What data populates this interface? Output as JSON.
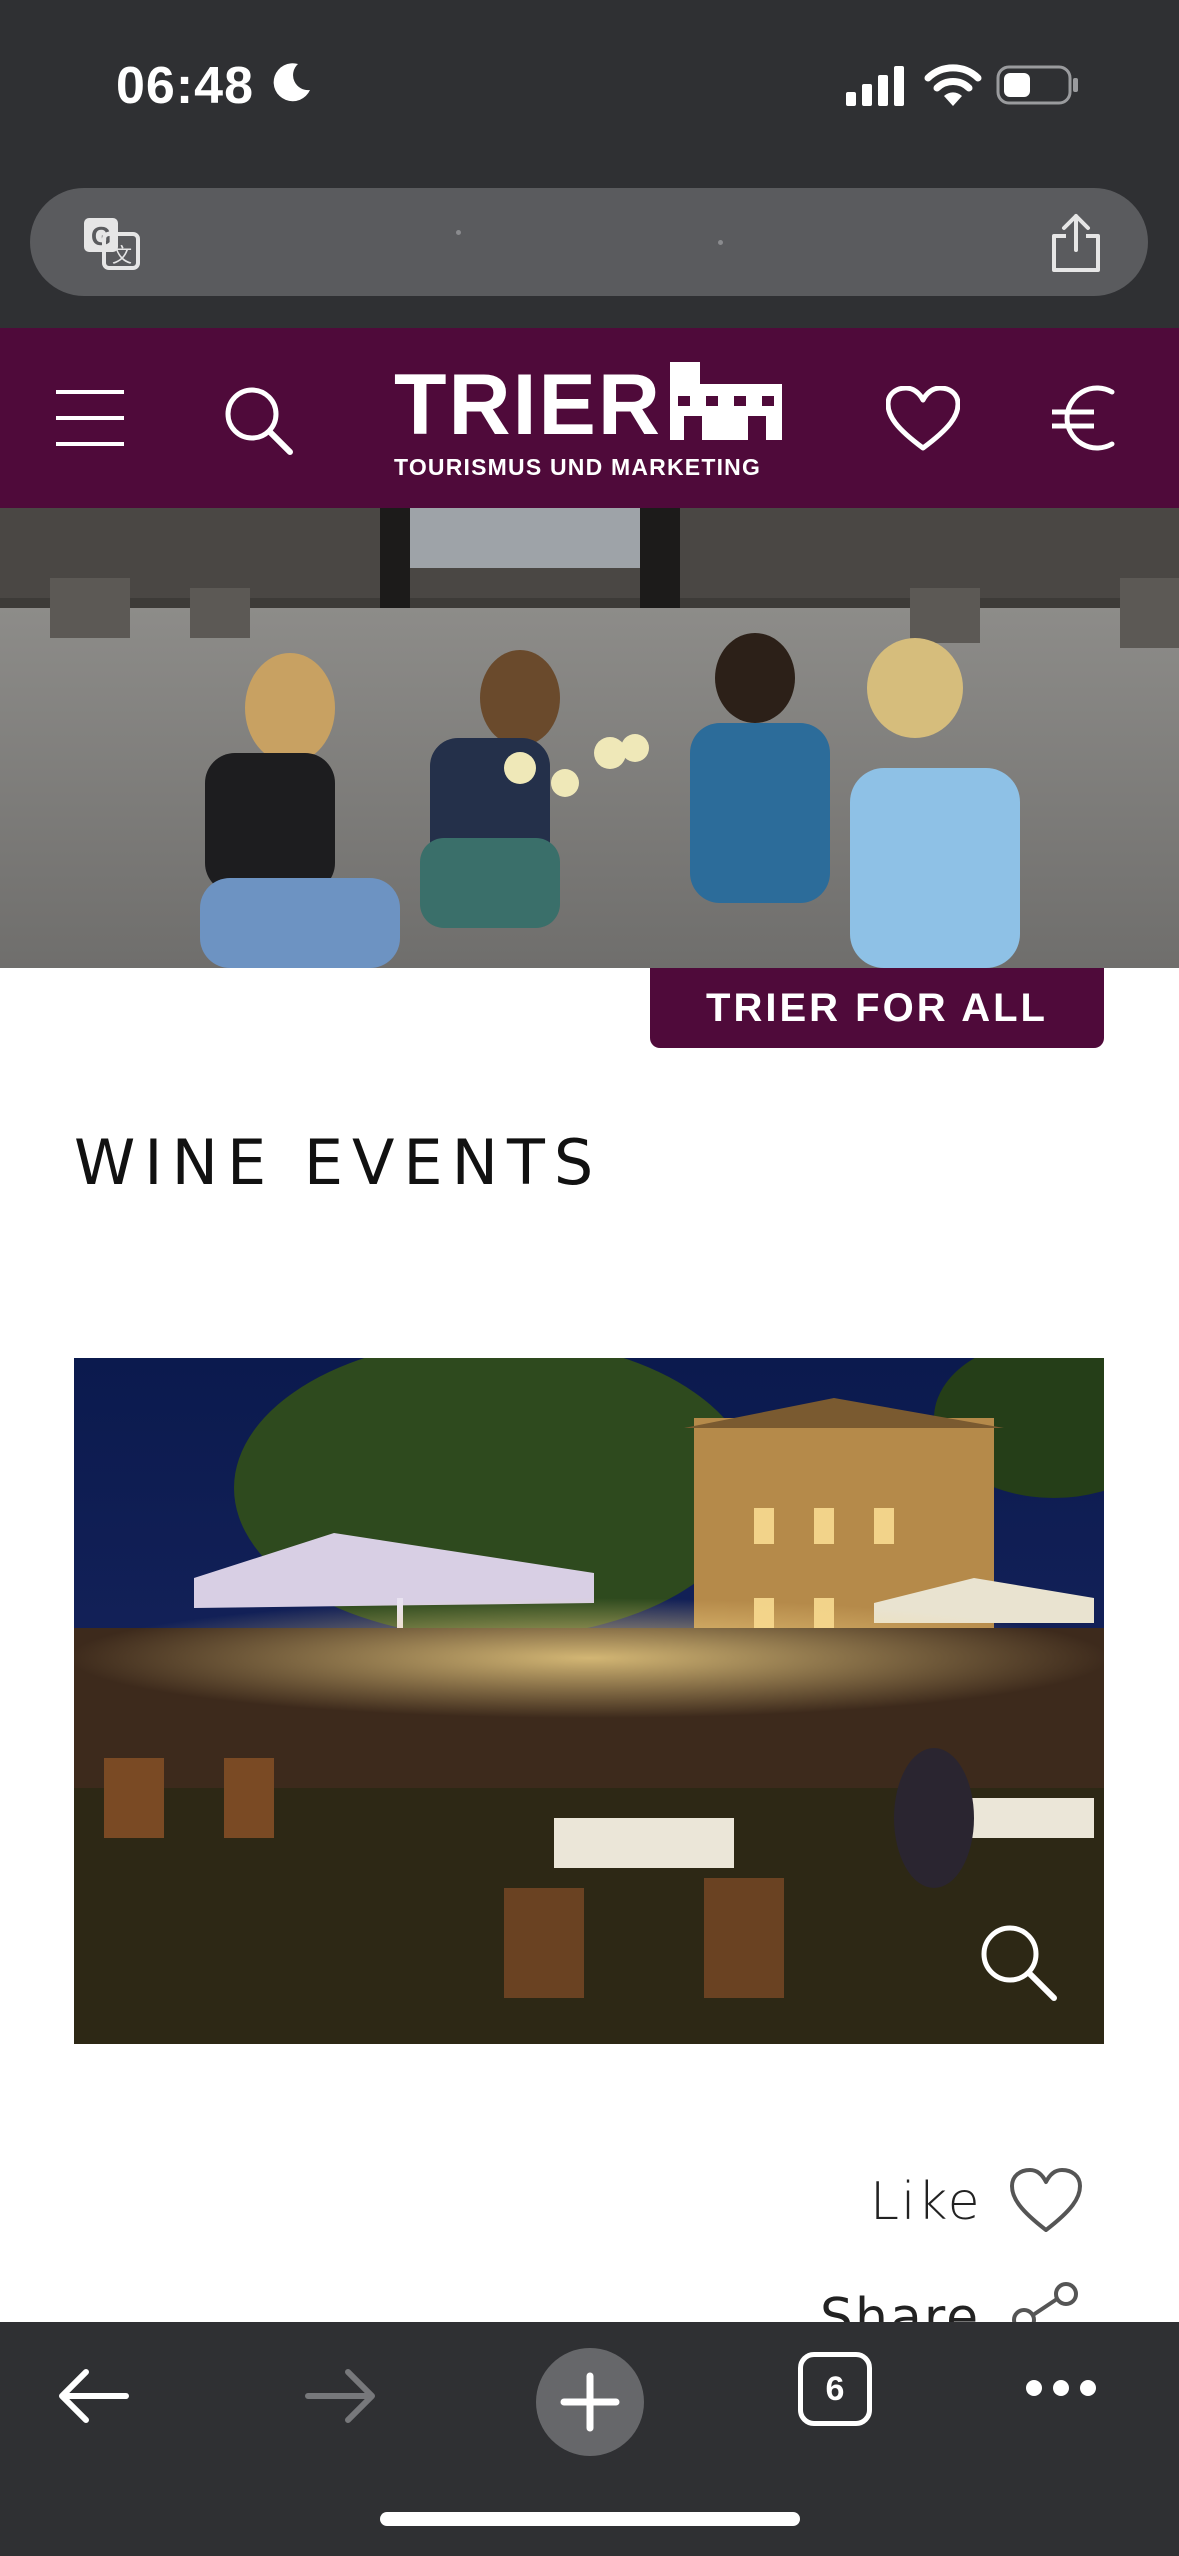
{
  "status_bar": {
    "time": "06:48"
  },
  "browser": {
    "tab_count": "6",
    "address_bar_text": ""
  },
  "site_header": {
    "logo_word": "TRIER",
    "logo_sub": "TOURISMUS UND MARKETING"
  },
  "hero": {
    "badge": "TRIER FOR ALL"
  },
  "main": {
    "title": "WINE EVENTS",
    "like_label": "Like",
    "share_label": "Share"
  },
  "colors": {
    "brand": "#4f0a3a",
    "chrome": "#2f3033",
    "address_bar": "#5a5b5e"
  },
  "icons": [
    "moon-icon",
    "signal-icon",
    "wifi-icon",
    "battery-icon",
    "translate-icon",
    "share-icon",
    "menu-icon",
    "search-icon",
    "heart-icon",
    "euro-icon",
    "zoom-icon",
    "back-icon",
    "forward-icon",
    "plus-icon",
    "more-icon"
  ]
}
